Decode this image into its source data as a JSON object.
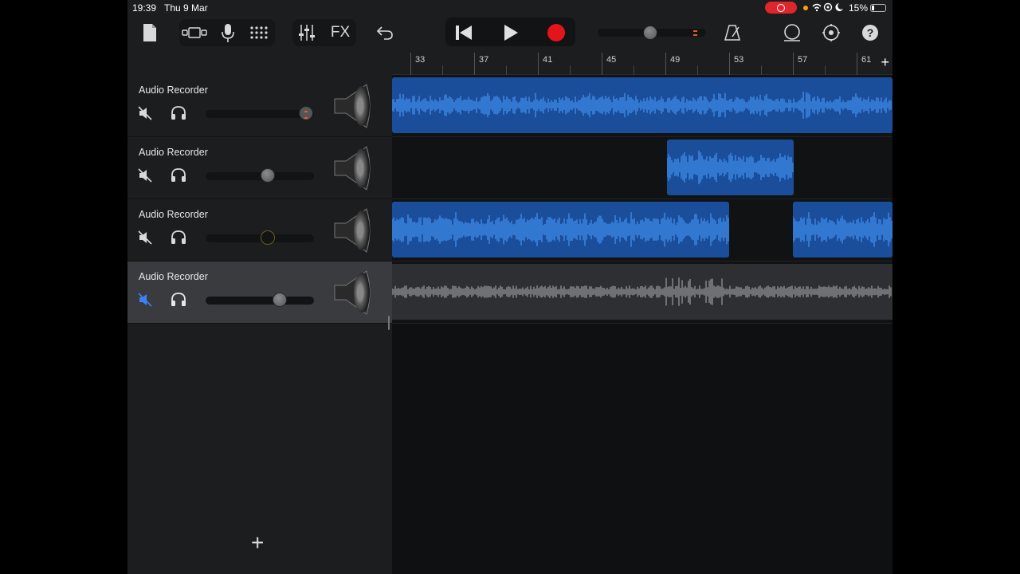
{
  "status_bar": {
    "time": "19:39",
    "date": "Thu 9 Mar",
    "battery": "15%"
  },
  "toolbar": {
    "fx_label": "FX"
  },
  "ruler": {
    "bars": [
      "33",
      "37",
      "41",
      "45",
      "49",
      "53",
      "57",
      "61"
    ]
  },
  "tracks": [
    {
      "name": "Audio Recorder",
      "muted": false,
      "volume": 0.9,
      "selected": false
    },
    {
      "name": "Audio Recorder",
      "muted": false,
      "volume": 0.57,
      "selected": false
    },
    {
      "name": "Audio Recorder",
      "muted": false,
      "volume": 0.57,
      "selected": false
    },
    {
      "name": "Audio Recorder",
      "muted": true,
      "volume": 0.68,
      "selected": true
    }
  ],
  "colors": {
    "region_blue": "#1b4e9a",
    "wave_blue": "#3d8be8",
    "record_red": "#e3141b",
    "mute_active": "#3a82f7"
  }
}
